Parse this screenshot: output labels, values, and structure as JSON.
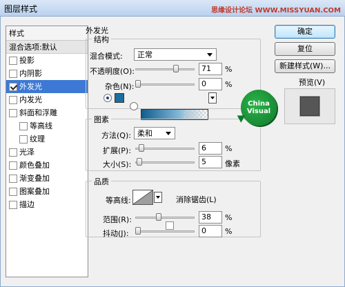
{
  "window": {
    "title": "图层样式",
    "watermark": "思缘设计论坛 WWW.MISSYUAN.COM"
  },
  "styles_panel": {
    "header": "样式",
    "blend_item": "混合选项:默认",
    "items": [
      {
        "label": "投影",
        "checked": false,
        "sub": false,
        "selected": false
      },
      {
        "label": "内阴影",
        "checked": false,
        "sub": false,
        "selected": false
      },
      {
        "label": "外发光",
        "checked": true,
        "sub": false,
        "selected": true
      },
      {
        "label": "内发光",
        "checked": false,
        "sub": false,
        "selected": false
      },
      {
        "label": "斜面和浮雕",
        "checked": false,
        "sub": false,
        "selected": false
      },
      {
        "label": "等高线",
        "checked": false,
        "sub": true,
        "selected": false
      },
      {
        "label": "纹理",
        "checked": false,
        "sub": true,
        "selected": false
      },
      {
        "label": "光泽",
        "checked": false,
        "sub": false,
        "selected": false
      },
      {
        "label": "颜色叠加",
        "checked": false,
        "sub": false,
        "selected": false
      },
      {
        "label": "渐变叠加",
        "checked": false,
        "sub": false,
        "selected": false
      },
      {
        "label": "图案叠加",
        "checked": false,
        "sub": false,
        "selected": false
      },
      {
        "label": "描边",
        "checked": false,
        "sub": false,
        "selected": false
      }
    ]
  },
  "outer_glow": {
    "title": "外发光",
    "structure": {
      "title": "结构",
      "blend_mode_label": "混合模式:",
      "blend_mode_value": "正常",
      "opacity_label": "不透明度(O):",
      "opacity_value": "71",
      "opacity_level": 71,
      "noise_label": "杂色(N):",
      "noise_value": "0",
      "noise_level": 0,
      "percent": "%",
      "glow_color": "#1a6fa0"
    },
    "elements": {
      "title": "图素",
      "method_label": "方法(Q):",
      "method_value": "柔和",
      "spread_label": "扩展(P):",
      "spread_value": "6",
      "spread_level": 6,
      "size_label": "大小(S):",
      "size_value": "5",
      "size_unit": "像素",
      "size_level": 2,
      "percent": "%"
    },
    "quality": {
      "title": "品质",
      "contour_label": "等高线:",
      "antialias_label": "消除锯齿(L)",
      "range_label": "范围(R):",
      "range_value": "38",
      "range_level": 38,
      "jitter_label": "抖动(J):",
      "jitter_value": "0",
      "jitter_level": 0,
      "percent": "%"
    }
  },
  "buttons": {
    "ok": "确定",
    "reset": "复位",
    "new_style": "新建样式(W)...",
    "preview_label": "预览(V)"
  },
  "logo": {
    "line1": "China",
    "line2": "Visual"
  }
}
